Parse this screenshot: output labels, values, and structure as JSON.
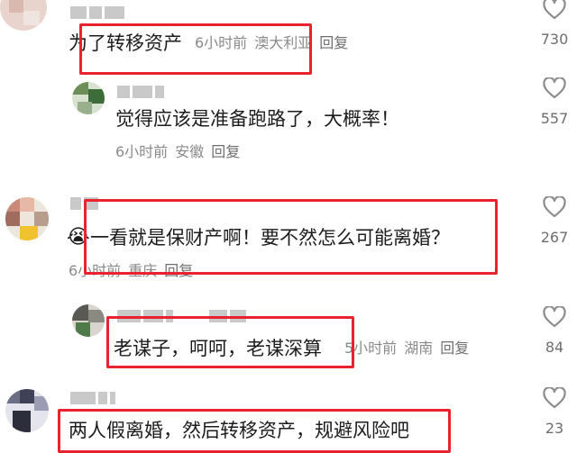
{
  "comments": [
    {
      "text": "为了转移资产",
      "time": "6小时前",
      "location": "澳大利亚",
      "reply": "回复",
      "likes": "730"
    },
    {
      "text": "觉得应该是准备跑路了，大概率！",
      "time": "6小时前",
      "location": "安徽",
      "reply": "回复",
      "likes": "557"
    },
    {
      "text": "一看就是保财产啊！要不然怎么可能离婚？",
      "time": "6小时前",
      "location": "重庆",
      "reply": "回复",
      "likes": "267"
    },
    {
      "text": "老谋子，呵呵，老谋深算",
      "time": "5小时前",
      "location": "湖南",
      "reply": "回复",
      "likes": "84"
    },
    {
      "text": "两人假离婚，然后转移资产，规避风险吧",
      "likes": "23"
    }
  ],
  "icons": {
    "like": "heart-outline-icon",
    "emoji": "crying-face-icon"
  },
  "colors": {
    "highlight_box": "#e8232f",
    "meta_text": "#8a8a8a",
    "like_count": "#6e6e6e"
  }
}
